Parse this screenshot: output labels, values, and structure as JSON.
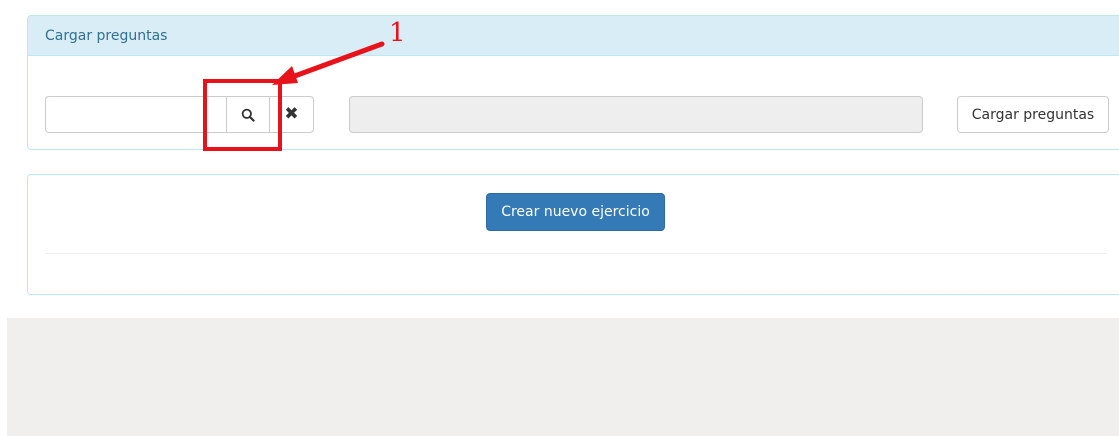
{
  "panel": {
    "title": "Cargar preguntas"
  },
  "search": {
    "value": "",
    "search_icon": "search-icon",
    "clear_icon": "close-icon",
    "clear_glyph": "✖"
  },
  "file_display": {
    "value": ""
  },
  "actions": {
    "load_label": "Cargar preguntas",
    "create_label": "Crear nuevo ejercicio"
  },
  "annotation": {
    "number": "1",
    "color": "#e8121a"
  },
  "colors": {
    "panel_heading_bg": "#d9edf7",
    "panel_border": "#bce8f1",
    "panel_title": "#31708f",
    "primary": "#337ab7",
    "page_bg": "#f1eeee"
  }
}
